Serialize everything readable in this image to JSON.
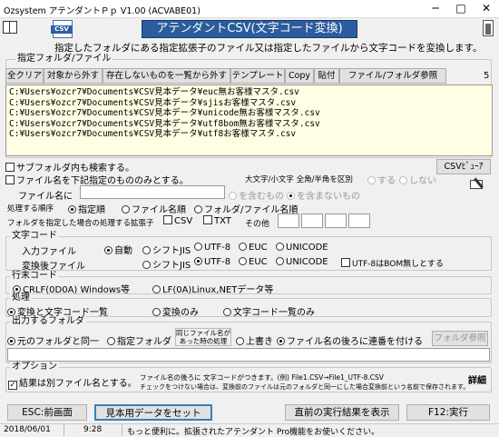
{
  "window": {
    "title": "Ozsystem アテンダントＰｐ V1.00 (ACVABE01)",
    "min": "─",
    "max": "□",
    "close": "✕"
  },
  "header": {
    "logo": "CSV",
    "title": "アテンダントCSV(文字コード変換)",
    "description": "指定したフォルダにある指定拡張子のファイル又は指定したファイルから文字コードを変換します。"
  },
  "file_group": {
    "label": "指定フォルダ/ファイル",
    "count": "5",
    "buttons": {
      "clear_all": "全クリア",
      "remove": "対象から外す",
      "remove_missing": "存在しないものを一覧から外す",
      "template": "テンプレート",
      "copy": "Copy",
      "paste": "貼付",
      "browse": "ファイル/フォルダ参照"
    },
    "files": [
      "C:¥Users¥ozcr7¥Documents¥CSV見本データ¥euc無お客様マスタ.csv",
      "C:¥Users¥ozcr7¥Documents¥CSV見本データ¥sjisお客様マスタ.csv",
      "C:¥Users¥ozcr7¥Documents¥CSV見本データ¥unicode無お客様マスタ.csv",
      "C:¥Users¥ozcr7¥Documents¥CSV見本データ¥utf8bom無お客様マスタ.csv",
      "C:¥Users¥ozcr7¥Documents¥CSV見本データ¥utf8お客様マスタ.csv"
    ]
  },
  "options": {
    "search_subfolders": "サブフォルダ内も検索する。",
    "filename_filter": "ファイル名を下記指定のもののみとする。",
    "case_label": "大文字/小文字 全角/半角を区別",
    "case_yes": "する",
    "case_no": "しない",
    "csv_viewer": "CSVﾋﾞｭｰｱ",
    "filename_label": "ファイル名に",
    "filename_value": "",
    "include": "を含むもの",
    "exclude": "を含まないもの",
    "order_label": "処理する順序",
    "order_options": [
      "指定順",
      "ファイル名順",
      "フォルダ/ファイル名順"
    ],
    "ext_label": "フォルダを指定した場合の処理する拡張子",
    "ext_csv": "CSV",
    "ext_txt": "TXT",
    "ext_other": "その他"
  },
  "charcode": {
    "label": "文字コード",
    "input_label": "入力ファイル",
    "output_label": "変換後ファイル",
    "input_options": [
      "自動",
      "シフトJIS",
      "UTF-8",
      "EUC",
      "UNICODE"
    ],
    "output_options": [
      "シフトJIS",
      "UTF-8",
      "EUC",
      "UNICODE"
    ],
    "bom_none": "UTF-8はBOM無しとする"
  },
  "newline": {
    "label": "行末コード",
    "options": [
      "CRLF(0D0A) Windows等",
      "LF(0A)Linux,NETデータ等"
    ]
  },
  "process": {
    "label": "処理",
    "options": [
      "変換と文字コード一覧",
      "変換のみ",
      "文字コード一覧のみ"
    ]
  },
  "output_folder": {
    "label": "出力するフォルダ",
    "same": "元のフォルダと同一",
    "specified": "指定フォルダ",
    "same_name_label": "同じファイル名が\nあった時の処理",
    "overwrite": "上書き",
    "append_number": "ファイル名の後ろに連番を付ける",
    "browse": "フォルダ参照",
    "path": ""
  },
  "option": {
    "label": "オプション",
    "separate": "結果は別ファイル名とする。",
    "note1": "ファイル名の後ろに 文字コードがつきます。(例) File1.CSV→File1_UTF-8.CSV",
    "note2": "チェックをつけない場合は、変換前のファイルは元のフォルダと同一にした場合変換前という名前で保存されます。",
    "detail": "詳細"
  },
  "footer": {
    "esc": "ESC:前画面",
    "sample": "見本用データをセット",
    "last_result": "直前の実行結果を表示",
    "run": "F12:実行"
  },
  "status": {
    "date": "2018/06/01",
    "time": "9:28",
    "message": "もっと便利に。拡張されたアテンダント Pro機能をお使いください。"
  }
}
